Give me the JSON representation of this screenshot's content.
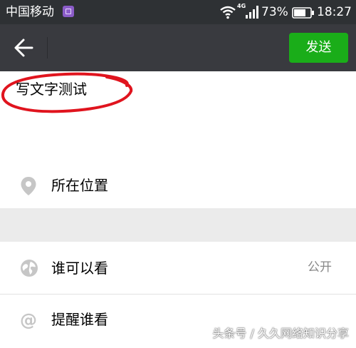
{
  "status_bar": {
    "carrier": "中国移动",
    "network_type": "4G",
    "battery": "73%",
    "time": "18:27"
  },
  "toolbar": {
    "send_label": "发送"
  },
  "compose": {
    "text": "写文字测试",
    "annotation_color": "#e0141e"
  },
  "rows": {
    "location_label": "所在位置",
    "visibility_label": "谁可以看",
    "visibility_value": "公开",
    "remind_label": "提醒谁看"
  },
  "watermark": "头条号 / 久久网络知识分享",
  "colors": {
    "accent": "#1aad19",
    "toolbar": "#393a3f",
    "statusbar": "#2e3134"
  }
}
